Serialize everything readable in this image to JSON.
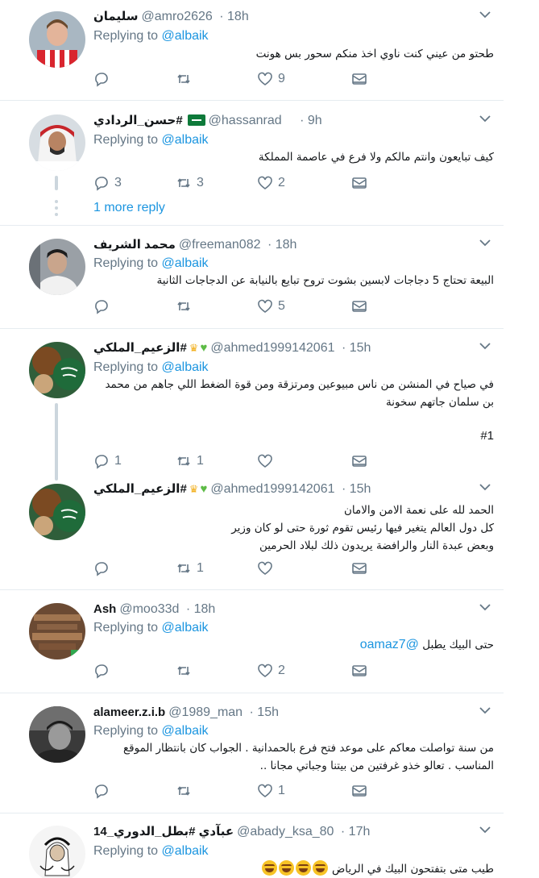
{
  "tweets": [
    {
      "name": "سليمان",
      "handle": "@amro2626",
      "time": "· 18h",
      "replying_prefix": "Replying to",
      "replying_to": "@albaik",
      "lines": [
        "طحتو من عيني كنت ناوي اخذ منكم سحور بس هونت"
      ],
      "counts": {
        "reply": "",
        "retweet": "",
        "like": "9"
      }
    },
    {
      "name": "حسن_الردادي#",
      "handle": "@hassanrad",
      "time": "· 9h",
      "replying_prefix": "Replying to",
      "replying_to": "@albaik",
      "lines": [
        "كيف تبايعون وانتم مالكم ولا فرع في عاصمة المملكة"
      ],
      "counts": {
        "reply": "3",
        "retweet": "3",
        "like": "2"
      },
      "more_reply": "1 more reply"
    },
    {
      "name": "محمد الشريف",
      "handle": "@freeman082",
      "time": "· 18h",
      "replying_prefix": "Replying to",
      "replying_to": "@albaik",
      "lines": [
        "البيعة تحتاج 5 دجاجات لابسين بشوت تروح تبايع بالنيابة عن الدجاجات الثانية"
      ],
      "counts": {
        "reply": "",
        "retweet": "",
        "like": "5"
      }
    },
    {
      "name": "الزعيم_الملكي#",
      "handle": "@ahmed1999142061",
      "time": "· 15h",
      "replying_prefix": "Replying to",
      "replying_to": "@albaik",
      "lines": [
        "في صياح في المنشن من ناس مبيوعين ومرتزقة ومن قوة الضغط اللي جاهم من محمد",
        "بن سلمان جاتهم سخونة",
        "",
        "#1"
      ],
      "counts": {
        "reply": "1",
        "retweet": "1",
        "like": ""
      }
    },
    {
      "name": "الزعيم_الملكي#",
      "handle": "@ahmed1999142061",
      "time": "· 15h",
      "lines": [
        "الحمد لله على نعمة الامن والامان",
        "كل دول العالم يتغير فيها رئيس تقوم ثورة حتى لو كان وزير",
        "وبعض عبدة النار والرافضة يريدون ذلك لبلاد الحرمين"
      ],
      "counts": {
        "reply": "",
        "retweet": "1",
        "like": ""
      }
    },
    {
      "name": "Ash",
      "handle": "@moo33d",
      "time": "· 18h",
      "replying_prefix": "Replying to",
      "replying_to": "@albaik",
      "text_main": "حتى البيك يطبل",
      "text_mention": "@oamaz7",
      "counts": {
        "reply": "",
        "retweet": "",
        "like": "2"
      }
    },
    {
      "name": "alameer.z.i.b",
      "handle": "@1989_man",
      "time": "· 15h",
      "replying_prefix": "Replying to",
      "replying_to": "@albaik",
      "lines": [
        "من سنة تواصلت معاكم على موعد فتح فرع بالحمدانية . الجواب كان بانتظار الموقع",
        "المناسب . تعالو خذو غرفتين من بيتنا وجباتي مجانا .."
      ],
      "counts": {
        "reply": "",
        "retweet": "",
        "like": "1"
      }
    },
    {
      "name": "عبآدي #بطل_الدوري_14",
      "handle": "@abady_ksa_80",
      "time": "· 17h",
      "replying_prefix": "Replying to",
      "replying_to": "@albaik",
      "lines": [
        "طيب متى بتفتحون البيك في الرياض"
      ]
    }
  ],
  "colors": {
    "link": "#1b95e0",
    "muted": "#657786",
    "text": "#14171a",
    "divider": "#e6ecf0",
    "thread": "#ccd6dd"
  },
  "icons": [
    "reply-icon",
    "retweet-icon",
    "like-icon",
    "message-icon",
    "caret-down-icon"
  ]
}
